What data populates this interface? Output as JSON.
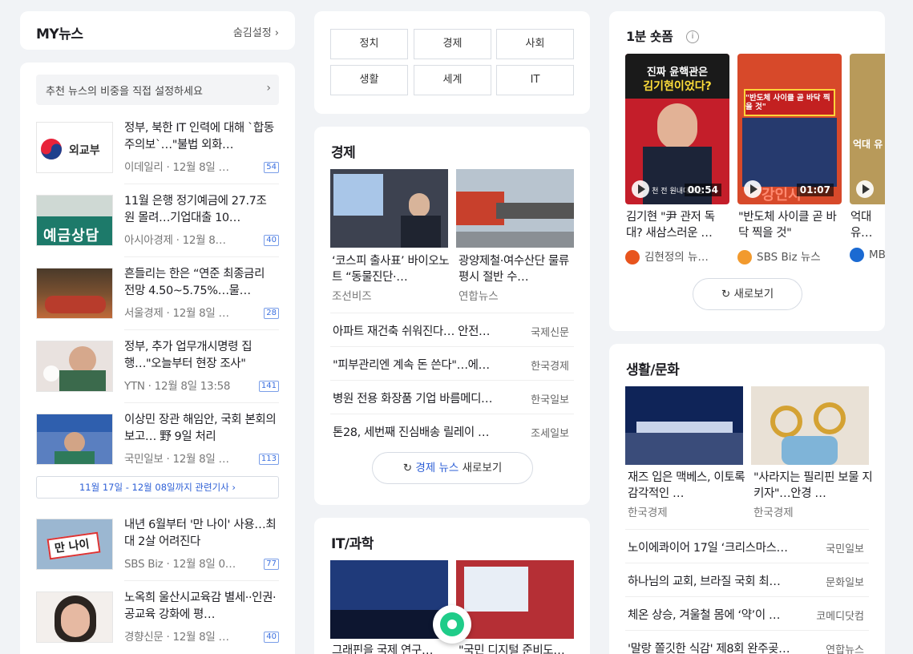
{
  "my_news": {
    "title": "MY뉴스",
    "hide_setting": "숨김설정 ›",
    "setting_prompt": "추천 뉴스의 비중을 직접 설정하세요",
    "setting_arrow": "›",
    "items": [
      {
        "headline": "정부, 북한 IT 인력에 대해 `합동주의보`…\"불법 외화…",
        "source": "이데일리 · 12월 8일 …",
        "count": "54",
        "thumb_text": "외교부"
      },
      {
        "headline": "11월 은행 정기예금에 27.7조원 몰려…기업대출 10…",
        "source": "아시아경제 · 12월 8…",
        "count": "40",
        "thumb_text": "예금상담"
      },
      {
        "headline": "흔들리는 한은 “연준 최종금리 전망 4.50~5.75%…물…",
        "source": "서울경제 · 12월 8일 …",
        "count": "28",
        "thumb_text": ""
      },
      {
        "headline": "정부, 추가 업무개시명령 집행…\"오늘부터 현장 조사\"",
        "source": "YTN · 12월 8일 13:58",
        "count": "141",
        "thumb_text": ""
      },
      {
        "headline": "이상민 장관 해임안, 국회 본회의 보고… 野 9일 처리",
        "source": "국민일보 · 12월 8일 …",
        "count": "113",
        "thumb_text": ""
      },
      {
        "headline": "내년 6월부터 '만 나이' 사용…최대 2살 어려진다",
        "source": "SBS Biz · 12월 8일 0…",
        "count": "77",
        "thumb_text": "만 나이"
      },
      {
        "headline": "노옥희 울산시교육감 별세··인권·공교육 강화에 평…",
        "source": "경향신문 · 12월 8일 …",
        "count": "40",
        "thumb_text": ""
      }
    ],
    "related_link": "11월 17일 - 12월 08일까지 관련기사 ›"
  },
  "categories": [
    "정치",
    "경제",
    "사회",
    "생활",
    "세계",
    "IT"
  ],
  "economy": {
    "title": "경제",
    "photo_items": [
      {
        "caption": "‘코스피 출사표’ 바이오노트 “동물진단·…",
        "source": "조선비즈"
      },
      {
        "caption": "광양제철·여수산단 물류 평시 절반 수…",
        "source": "연합뉴스"
      }
    ],
    "list": [
      {
        "headline": "아파트 재건축 쉬워진다… 안전…",
        "press": "국제신문"
      },
      {
        "headline": "\"피부관리엔 계속 돈 쓴다\"…에…",
        "press": "한국경제"
      },
      {
        "headline": "병원 전용 화장품 기업 바름메디…",
        "press": "한국일보"
      },
      {
        "headline": "톤28, 세번째 진심배송 릴레이 …",
        "press": "조세일보"
      }
    ],
    "more_blue": "경제 뉴스",
    "more_rest": " 새로보기"
  },
  "it_science": {
    "title": "IT/과학",
    "photo_items": [
      {
        "caption": "그래핀을 국제 연구…"
      },
      {
        "caption": "\"국민 디지털 준비도…"
      }
    ]
  },
  "shorts": {
    "title": "1분 숏폼",
    "info_icon": "i",
    "videos": [
      {
        "caption": "김기현 \"尹 관저 독대? 새삼스러운 …",
        "channel": "김현정의 뉴…",
        "duration": "00:54",
        "overlay_top": "진짜 윤핵관은",
        "overlay_main": "김기현이었다?",
        "overlay_bottom": "천 전 원내대표인",
        "dot_color": "#e8541d"
      },
      {
        "caption": "\"반도체 사이클 곧 바닥 찍을 것\"",
        "channel": "SBS Biz 뉴스",
        "duration": "01:07",
        "overlay_top": "\"반도체 사이클 곧 바닥 찍을 것\"",
        "overlay_main": "",
        "overlay_bottom": "강인시",
        "dot_color": "#f29a2e"
      },
      {
        "caption": "억대 유… 작한 금…",
        "channel": "MB…",
        "duration": "",
        "overlay_top": "",
        "overlay_main": "억대 유",
        "overlay_bottom": "",
        "dot_color": "#1b6ad2"
      }
    ],
    "refresh": "새로보기"
  },
  "life": {
    "title": "생활/문화",
    "photo_items": [
      {
        "caption": "재즈 입은 맥베스, 이토록 감각적인 …",
        "source": "한국경제"
      },
      {
        "caption": "\"사라지는 필리핀 보물 지키자\"…안경 …",
        "source": "한국경제"
      }
    ],
    "list": [
      {
        "headline": "노이에콰이어 17일 ‘크리스마스…",
        "press": "국민일보"
      },
      {
        "headline": "하나님의 교회, 브라질 국회 최…",
        "press": "문화일보"
      },
      {
        "headline": "체온 상승, 겨울철 몸에 ‘약’이 …",
        "press": "코메디닷컴"
      },
      {
        "headline": "'말랑 쫄깃한 식감' 제8회 완주곶…",
        "press": "연합뉴스"
      }
    ]
  },
  "icons": {
    "refresh": "refresh-icon",
    "chevron": "chevron-right-icon",
    "play": "play-icon"
  },
  "colors": {
    "link_blue": "#2d5fd6",
    "floating_green": "#1fcc89"
  }
}
